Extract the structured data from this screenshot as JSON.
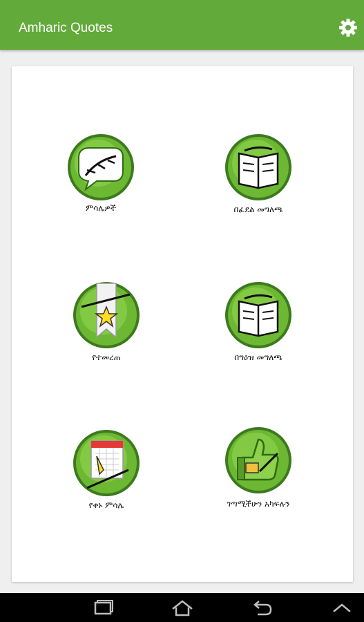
{
  "app": {
    "title": "Amharic Quotes",
    "settings_icon": "gear-icon",
    "colors": {
      "primary": "#62aa3a",
      "primary_dark": "#3d7a1e",
      "badge_light": "#8dd14c"
    }
  },
  "menu": {
    "items": [
      {
        "label": "ምሳሌዎች",
        "icon": "speech-bubble-icon"
      },
      {
        "label": "በፊደል መግለጫ",
        "icon": "alphabet-book-icon"
      },
      {
        "label": "የተመረጠ",
        "icon": "bookmark-star-icon"
      },
      {
        "label": "በግዕዝ መግለጫ",
        "icon": "geez-book-icon"
      },
      {
        "label": "የቀኑ ምሳሌ",
        "icon": "calendar-pin-icon"
      },
      {
        "label": "ገጣሚችሁን አካፍሉን",
        "icon": "thumbs-up-icon"
      }
    ]
  },
  "system_nav": {
    "buttons": [
      "recent-apps-icon",
      "home-icon",
      "back-icon",
      "chevron-up-icon"
    ]
  }
}
